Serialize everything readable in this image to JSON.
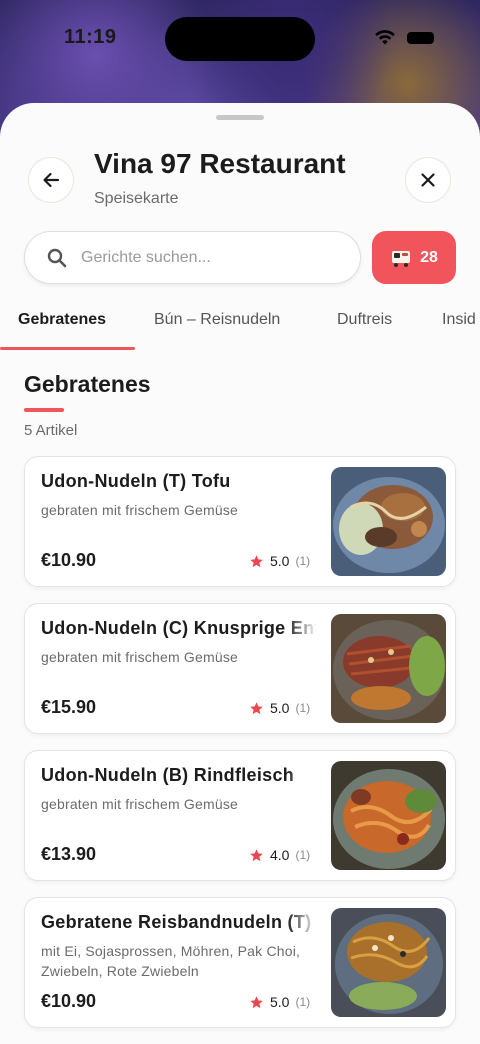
{
  "status_bar": {
    "time": "11:19"
  },
  "header": {
    "title": "Vina 97 Restaurant",
    "subtitle": "Speisekarte"
  },
  "search": {
    "placeholder": "Gerichte suchen...",
    "value": ""
  },
  "cart": {
    "count": "28",
    "icon": "cart-icon"
  },
  "tabs": [
    {
      "label": "Gebratenes",
      "active": true
    },
    {
      "label": "Bún – Reisnudeln",
      "active": false
    },
    {
      "label": "Duftreis",
      "active": false
    },
    {
      "label": "Insid",
      "active": false
    }
  ],
  "section": {
    "title": "Gebratenes",
    "count_label": "5 Artikel"
  },
  "items": [
    {
      "name": "Udon-Nudeln (T) Tofu",
      "description": "gebraten mit frischem Gemüse",
      "price": "€10.90",
      "rating": "5.0",
      "rating_count": "(1)"
    },
    {
      "name": "Udon-Nudeln (C) Knusprige Ente",
      "description": "gebraten mit frischem Gemüse",
      "price": "€15.90",
      "rating": "5.0",
      "rating_count": "(1)"
    },
    {
      "name": "Udon-Nudeln (B) Rindfleisch",
      "description": "gebraten mit frischem Gemüse",
      "price": "€13.90",
      "rating": "4.0",
      "rating_count": "(1)"
    },
    {
      "name": "Gebratene Reisbandnudeln (T)",
      "description": "mit Ei, Sojasprossen, Möhren, Pak Choi, Zwiebeln, Rote Zwiebeln",
      "price": "€10.90",
      "rating": "5.0",
      "rating_count": "(1)"
    }
  ],
  "colors": {
    "accent": "#f2545b",
    "star": "#e8484f"
  }
}
